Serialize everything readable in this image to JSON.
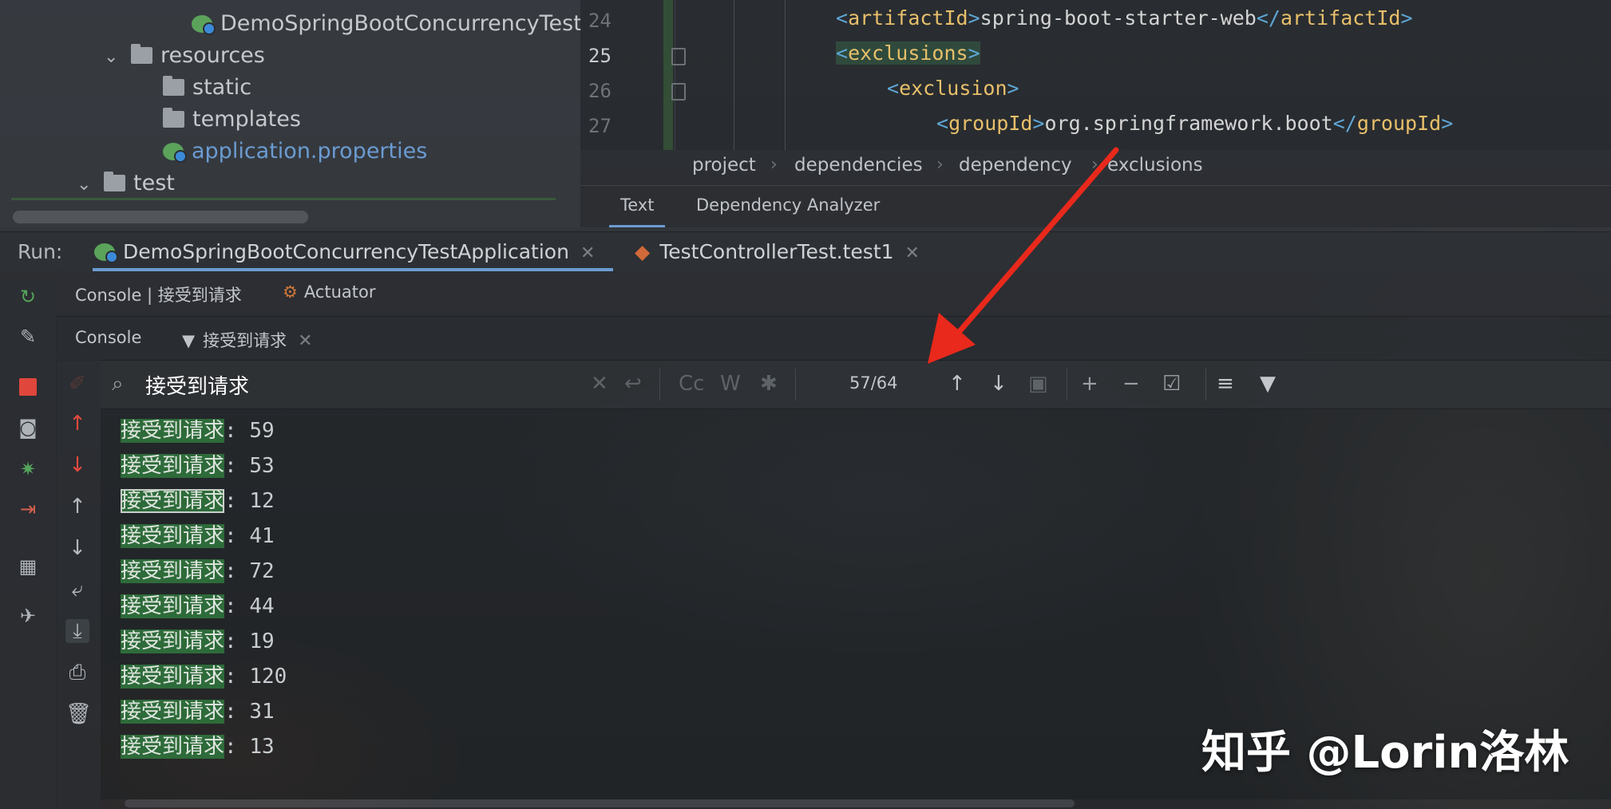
{
  "project_tree": {
    "items": [
      {
        "label": "DemoSpringBootConcurrencyTest",
        "icon": "spring-boot-class-icon"
      },
      {
        "label": "resources",
        "icon": "resources-folder-icon"
      },
      {
        "label": "static",
        "icon": "folder-icon"
      },
      {
        "label": "templates",
        "icon": "folder-icon"
      },
      {
        "label": "application.properties",
        "icon": "spring-properties-icon"
      },
      {
        "label": "test",
        "icon": "folder-icon"
      }
    ]
  },
  "editor": {
    "lines": [
      {
        "num": "24",
        "indent": "",
        "tag": "artifactId",
        "text": "spring-boot-starter-web",
        "close": "artifactId"
      },
      {
        "num": "25",
        "indent": "",
        "tag": "exclusions"
      },
      {
        "num": "26",
        "indent": "    ",
        "tag": "exclusion"
      },
      {
        "num": "27",
        "indent": "        ",
        "tag": "groupId",
        "text": "org.springframework.boot",
        "close": "groupId"
      }
    ],
    "breadcrumb": [
      "project",
      "dependencies",
      "dependency",
      "exclusions"
    ],
    "tabs": [
      "Text",
      "Dependency Analyzer"
    ]
  },
  "run_bar": {
    "label": "Run:",
    "tabs": [
      {
        "label": "DemoSpringBootConcurrencyTestApplication",
        "icon": "spring-boot-run-icon"
      },
      {
        "label": "TestControllerTest.test1",
        "icon": "junit-test-icon"
      }
    ]
  },
  "console_tabs": {
    "main": "Console | 接受到请求",
    "actuator": "Actuator",
    "sub_console": "Console",
    "sub_filter": "接受到请求"
  },
  "search": {
    "query": "接受到请求",
    "match_count": "57/64",
    "options": {
      "case": "Cc",
      "words": "W",
      "regex": "✱"
    }
  },
  "console_output": {
    "keyword": "接受到请求",
    "separator": ": ",
    "lines": [
      {
        "prefix": "接受到请求",
        "value": "59"
      },
      {
        "prefix": "接受到请求",
        "value": "53"
      },
      {
        "prefix": "接受到请求",
        "value": "12"
      },
      {
        "prefix": "接受到请求",
        "value": "41"
      },
      {
        "prefix": "接受到请求",
        "value": "72"
      },
      {
        "prefix": "接受到请求",
        "value": "44"
      },
      {
        "prefix": "接受到请求",
        "value": "19"
      },
      {
        "prefix": "接受到请求",
        "value": "120"
      },
      {
        "prefix": "接受到请求",
        "value": "31"
      },
      {
        "prefix": "接受到请求",
        "value": "13"
      }
    ]
  },
  "watermark": "知乎 @Lorin洛林",
  "colors": {
    "accent": "#6b9bd1",
    "match_highlight": "#2e6b3a",
    "arrow": "#e8291c",
    "xml_tag": "#e8bf6a",
    "xml_bracket": "#5fa7d6"
  }
}
